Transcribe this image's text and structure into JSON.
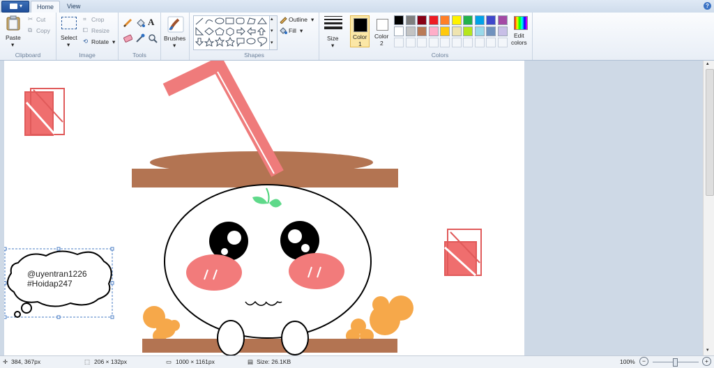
{
  "tabs": [
    "Home",
    "View"
  ],
  "clipboard": {
    "paste": "Paste",
    "cut": "Cut",
    "copy": "Copy",
    "group": "Clipboard"
  },
  "image": {
    "select": "Select",
    "crop": "Crop",
    "resize": "Resize",
    "rotate": "Rotate",
    "group": "Image"
  },
  "tools": {
    "group": "Tools"
  },
  "brushes": {
    "label": "Brushes"
  },
  "shapes": {
    "outline": "Outline",
    "fill": "Fill",
    "group": "Shapes"
  },
  "size": {
    "label": "Size"
  },
  "colors": {
    "color1": "Color",
    "color1_num": "1",
    "color2": "Color",
    "color2_num": "2",
    "edit": "Edit",
    "edit2": "colors",
    "group": "Colors",
    "palette": [
      "#000000",
      "#7f7f7f",
      "#880015",
      "#ed1c24",
      "#ff7f27",
      "#fff200",
      "#22b14c",
      "#00a2e8",
      "#3f48cc",
      "#a349a4",
      "#ffffff",
      "#c3c3c3",
      "#b97a57",
      "#ffaec9",
      "#ffc90e",
      "#efe4b0",
      "#b5e61d",
      "#99d9ea",
      "#7092be",
      "#c8bfe7"
    ],
    "color1_value": "#000000",
    "color2_value": "#ffffff"
  },
  "canvas": {
    "bubble_line1": "@uyentran1226",
    "bubble_line2": "#Hoidap247"
  },
  "status": {
    "cursor": "384, 367px",
    "selection": "206 × 132px",
    "image_size": "1000 × 1161px",
    "file_size": "Size: 26.1KB",
    "zoom": "100%"
  }
}
